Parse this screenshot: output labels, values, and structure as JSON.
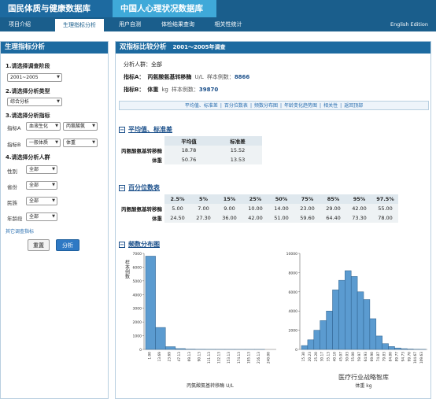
{
  "header": {
    "brand_primary": "国民体质与健康数据库",
    "brand_secondary": "中国人心理状况数据库"
  },
  "nav": {
    "items": [
      "项目介绍",
      "生理指标分析",
      "用户自测",
      "体检结果查询",
      "相关性统计"
    ],
    "active_index": 1,
    "english": "English Edition"
  },
  "sidebar": {
    "title": "生理指标分析",
    "step1_label": "1.请选择调查阶段",
    "stage_value": "2001~2005",
    "step2_label": "2.请选择分析类型",
    "type_value": "综合分析",
    "step3_label": "3.请选择分析指标",
    "indicator_a_label": "指标A",
    "indicator_a_category": "血液生化",
    "indicator_a_value": "丙氨酸氨",
    "indicator_b_label": "指标B",
    "indicator_b_category": "一般体质",
    "indicator_b_value": "体重",
    "step4_label": "4.请选择分析人群",
    "gender_label": "性别",
    "gender_value": "全部",
    "province_label": "省份",
    "province_value": "全部",
    "ethnicity_label": "民族",
    "ethnicity_value": "全部",
    "age_label": "年龄段",
    "age_value": "全部",
    "more_link": "其它调查指标",
    "reset_button": "重置",
    "analyze_button": "分析"
  },
  "main": {
    "title": "双指标比较分析",
    "subtitle": "2001～2005年调查",
    "population_label": "分析人群：",
    "population_value": "全部",
    "indicator_a_label": "指标A：",
    "indicator_a_name": "丙氨酸氨基转移酶",
    "indicator_a_unit": "U/L",
    "indicator_a_count_label": "样本例数：",
    "indicator_a_count": "8866",
    "indicator_b_label": "指标B：",
    "indicator_b_name": "体重",
    "indicator_b_unit": "kg",
    "indicator_b_count_label": "样本例数：",
    "indicator_b_count": "39870",
    "links": [
      "平均值、标准差",
      "百分位数表",
      "频数分布图",
      "年龄变化趋势图",
      "相关性",
      "返回顶部"
    ],
    "section_mean": "平均值、标准差",
    "mean_table": {
      "headers": [
        "平均值",
        "标准差"
      ],
      "rows": [
        {
          "name": "丙氨酸氨基转移酶",
          "values": [
            "18.78",
            "15.52"
          ]
        },
        {
          "name": "体重",
          "values": [
            "50.76",
            "13.53"
          ]
        }
      ]
    },
    "section_pct": "百分位数表",
    "pct_table": {
      "headers": [
        "2.5%",
        "5%",
        "15%",
        "25%",
        "50%",
        "75%",
        "85%",
        "95%",
        "97.5%"
      ],
      "rows": [
        {
          "name": "丙氨酸氨基转移酶",
          "values": [
            "5.00",
            "7.00",
            "9.00",
            "10.00",
            "14.00",
            "23.00",
            "29.00",
            "42.00",
            "55.00"
          ]
        },
        {
          "name": "体重",
          "values": [
            "24.50",
            "27.30",
            "36.00",
            "42.00",
            "51.00",
            "59.60",
            "64.40",
            "73.30",
            "78.00"
          ]
        }
      ]
    },
    "section_freq": "频数分布图"
  },
  "watermark": "医疗行业战略智库",
  "chart_data": [
    {
      "type": "bar",
      "title": "",
      "xlabel": "丙氨酸氨基转移酶 U/L",
      "ylabel": "样本例数",
      "ylim": [
        0,
        7000
      ],
      "yticks": [
        0,
        1000,
        2000,
        3000,
        4000,
        5000,
        6000,
        7000
      ],
      "categories": [
        "1.00",
        "13.69",
        "23.69",
        "47.13",
        "69.13",
        "90.13",
        "111.13",
        "132.13",
        "153.13",
        "174.13",
        "195.13",
        "216.13",
        "240.00"
      ],
      "values": [
        6800,
        1600,
        200,
        60,
        20,
        10,
        5,
        3,
        2,
        1,
        1,
        1,
        0
      ],
      "color": "#5b9bd0"
    },
    {
      "type": "bar",
      "title": "",
      "xlabel": "体重 kg",
      "ylabel": "",
      "ylim": [
        0,
        10000
      ],
      "yticks": [
        0,
        2000,
        4000,
        6000,
        8000,
        10000
      ],
      "categories": [
        "15.30",
        "20.23",
        "25.20",
        "30.17",
        "35.13",
        "40.10",
        "45.07",
        "50.03",
        "55.00",
        "59.97",
        "64.93",
        "69.90",
        "74.87",
        "79.83",
        "84.80",
        "89.77",
        "94.73",
        "99.70",
        "104.67",
        "109.63"
      ],
      "values": [
        400,
        1000,
        2000,
        3000,
        4000,
        6200,
        7200,
        8200,
        7600,
        6000,
        5200,
        3200,
        1400,
        600,
        300,
        150,
        80,
        40,
        20,
        10
      ],
      "color": "#5b9bd0"
    }
  ]
}
